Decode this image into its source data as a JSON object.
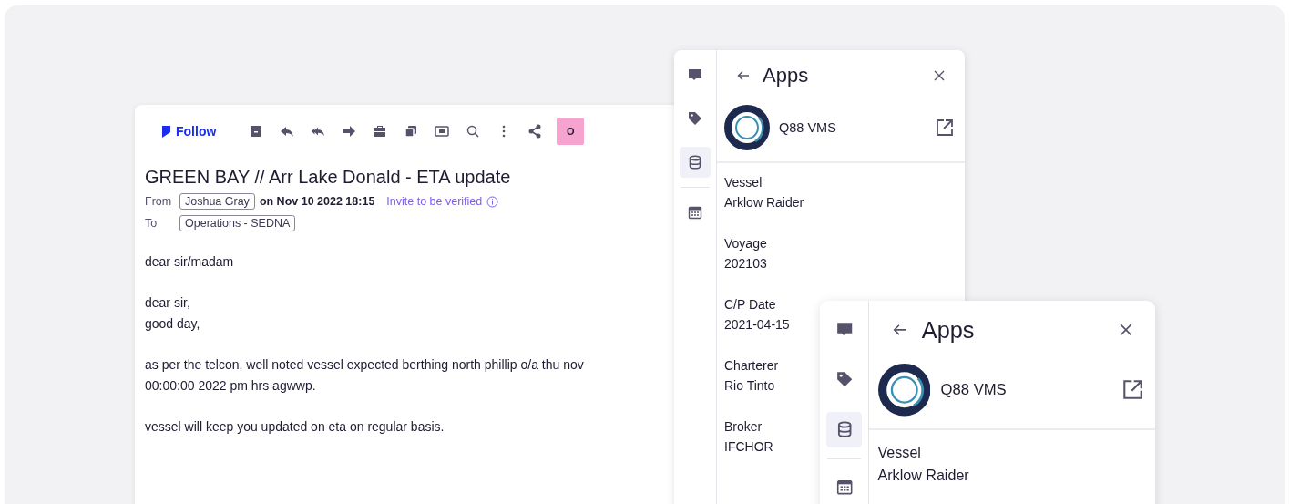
{
  "email": {
    "toolbar": {
      "follow_label": "Follow",
      "badge": "O"
    },
    "subject": "GREEN BAY // Arr Lake Donald - ETA update",
    "from": {
      "label": "From",
      "sender": "Joshua Gray",
      "date": "on Nov 10 2022 18:15",
      "verify_link": "Invite to be verified"
    },
    "to": {
      "label": "To",
      "recipient": "Operations - SEDNA"
    },
    "body": [
      [
        "dear sir/madam"
      ],
      [
        "dear sir,",
        "good day,"
      ],
      [
        "as per the telcon, well noted vessel expected berthing north phillip o/a thu nov",
        "00:00:00 2022 pm hrs agwwp."
      ],
      [
        "vessel will keep you updated on eta on regular basis."
      ]
    ]
  },
  "panels": [
    {
      "sidebar": [
        {
          "kind": "chat",
          "selected": false
        },
        {
          "kind": "tag",
          "selected": false
        },
        {
          "kind": "database",
          "selected": true
        },
        {
          "kind": "calendar",
          "selected": false
        }
      ],
      "title": "Apps",
      "app": {
        "name": "Q88 VMS"
      },
      "fields": [
        {
          "label": "Vessel",
          "value": "Arklow Raider"
        },
        {
          "label": "Voyage",
          "value": "202103"
        },
        {
          "label": "C/P Date",
          "value": "2021-04-15"
        },
        {
          "label": "Charterer",
          "value": "Rio Tinto"
        },
        {
          "label": "Broker",
          "value": "IFCHOR"
        }
      ]
    },
    {
      "sidebar": [
        {
          "kind": "chat",
          "selected": false
        },
        {
          "kind": "tag",
          "selected": false
        },
        {
          "kind": "database",
          "selected": true
        },
        {
          "kind": "calendar",
          "selected": false
        }
      ],
      "title": "Apps",
      "app": {
        "name": "Q88 VMS"
      },
      "fields": [
        {
          "label": "Vessel",
          "value": "Arklow Raider"
        }
      ]
    }
  ]
}
